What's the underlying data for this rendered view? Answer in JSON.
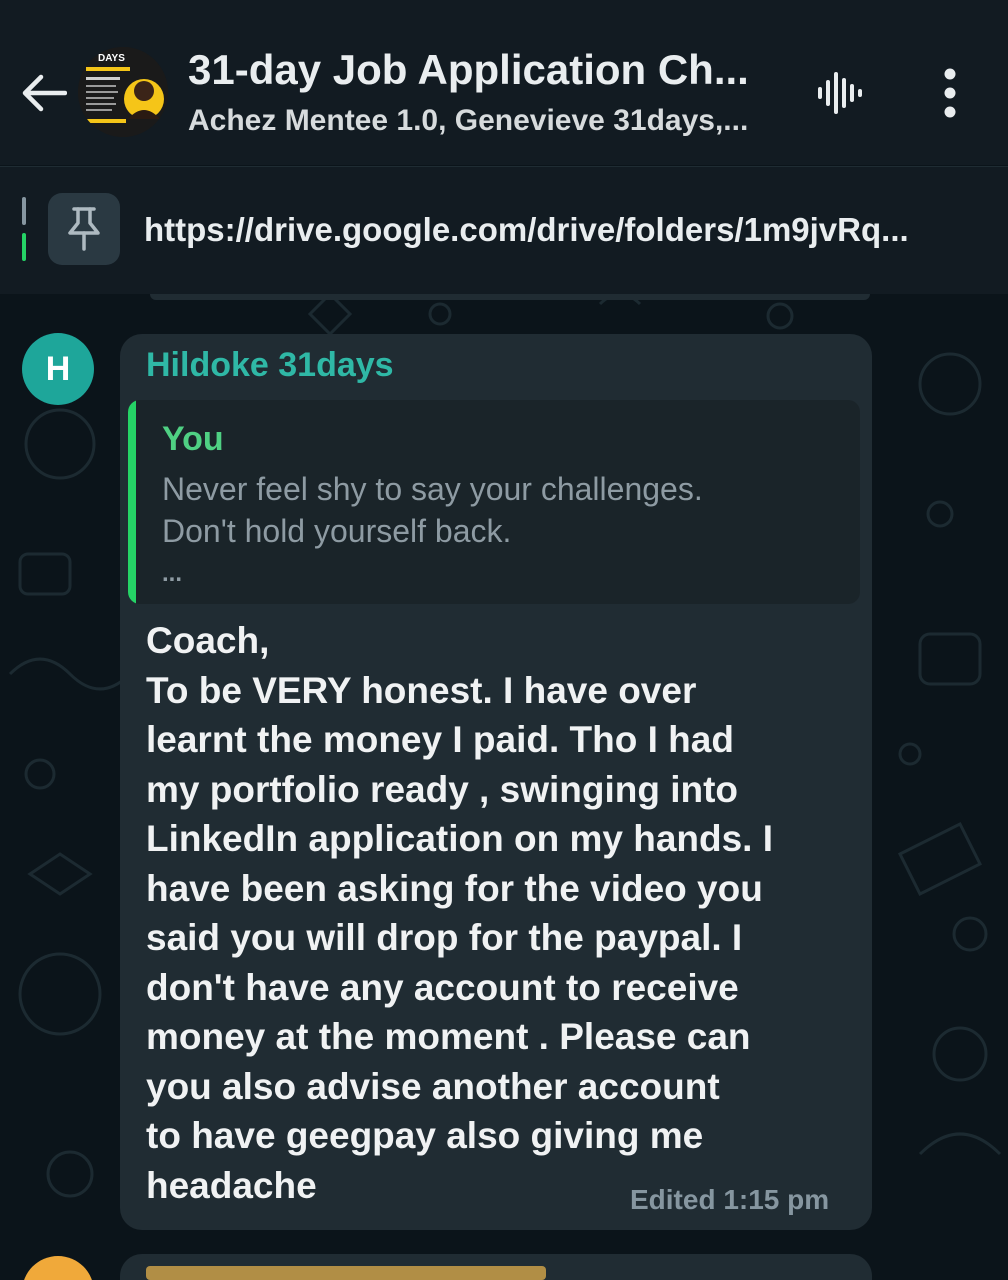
{
  "header": {
    "title": "31-day Job Application Ch...",
    "subtitle": "Achez Mentee 1.0, Genevieve 31days,...",
    "avatar_banner_text": "DAYS"
  },
  "pinned": {
    "text": "https://drive.google.com/drive/folders/1m9jvRq..."
  },
  "message": {
    "sender_initial": "H",
    "sender_name": "Hildoke 31days",
    "quote_author": "You",
    "quote_lines": [
      "Never feel shy to say your challenges.",
      "Don't hold yourself back."
    ],
    "quote_ellipsis": "...",
    "body_lines": [
      "Coach,",
      "To be VERY honest. I have over",
      "learnt  the money I paid. Tho I had",
      "my portfolio ready , swinging into",
      "LinkedIn application on my hands.  I",
      "have been asking for the video you",
      "said you will drop for the paypal. I",
      "don't have any account to receive",
      "money at the moment . Please can",
      "you also advise another account",
      "to have geegpay also giving me",
      "headache"
    ],
    "meta": "Edited 1:15 pm"
  },
  "colors": {
    "header_bg": "#121b22",
    "chat_bg": "#0b141a",
    "bubble_bg": "#202c33",
    "sender_name": "#2fb8a6",
    "quote_bar": "#25d366",
    "quote_author": "#4fd083",
    "sender_avatar": "#1ea69a"
  },
  "icons": [
    "back-arrow-icon",
    "group-avatar",
    "voice-call-icon",
    "more-vert-icon",
    "pin-icon"
  ]
}
